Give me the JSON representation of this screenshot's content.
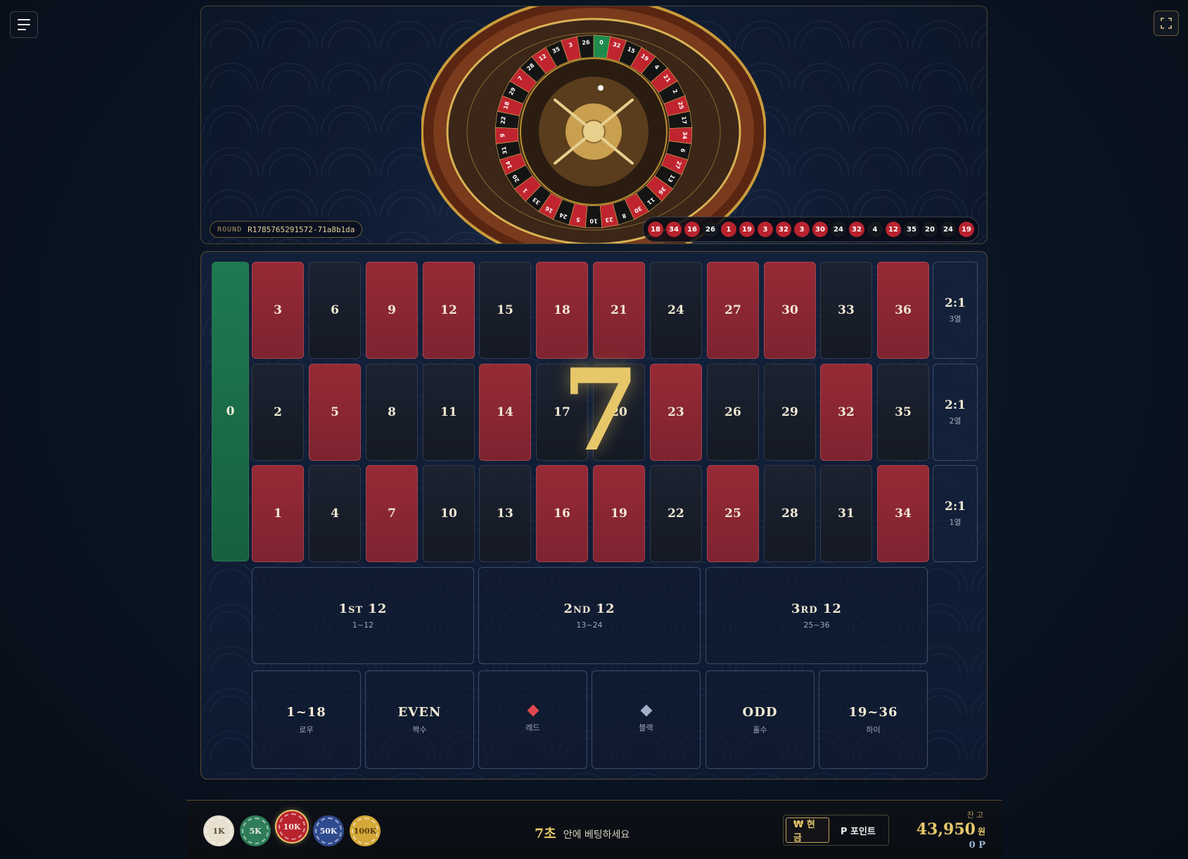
{
  "menu": {
    "icon": "hamburger-icon"
  },
  "fullscreen": {
    "icon": "fullscreen-icon"
  },
  "wheel": {
    "round_label": "ROUND",
    "round_id": "R1785765291572-71a8b1da",
    "pocket_numbers": [
      "0",
      "32",
      "15",
      "19",
      "4",
      "21",
      "2",
      "25",
      "17",
      "34",
      "6",
      "27",
      "13",
      "36",
      "11",
      "30",
      "8",
      "23",
      "10",
      "5",
      "24",
      "16",
      "33",
      "1",
      "20",
      "14",
      "31",
      "9",
      "22",
      "18",
      "29",
      "7",
      "28",
      "12",
      "35",
      "3",
      "26"
    ],
    "history": [
      {
        "n": "18",
        "c": "red"
      },
      {
        "n": "34",
        "c": "red"
      },
      {
        "n": "16",
        "c": "red"
      },
      {
        "n": "26",
        "c": "black"
      },
      {
        "n": "1",
        "c": "red"
      },
      {
        "n": "19",
        "c": "red"
      },
      {
        "n": "3",
        "c": "red"
      },
      {
        "n": "32",
        "c": "red"
      },
      {
        "n": "3",
        "c": "red"
      },
      {
        "n": "30",
        "c": "red"
      },
      {
        "n": "24",
        "c": "black"
      },
      {
        "n": "32",
        "c": "red"
      },
      {
        "n": "4",
        "c": "black"
      },
      {
        "n": "12",
        "c": "red"
      },
      {
        "n": "35",
        "c": "black"
      },
      {
        "n": "20",
        "c": "black"
      },
      {
        "n": "24",
        "c": "black"
      },
      {
        "n": "19",
        "c": "red"
      }
    ]
  },
  "board": {
    "zero": "0",
    "rows": [
      [
        {
          "n": "3",
          "c": "red"
        },
        {
          "n": "6",
          "c": "black"
        },
        {
          "n": "9",
          "c": "red"
        },
        {
          "n": "12",
          "c": "red"
        },
        {
          "n": "15",
          "c": "black"
        },
        {
          "n": "18",
          "c": "red"
        },
        {
          "n": "21",
          "c": "red"
        },
        {
          "n": "24",
          "c": "black"
        },
        {
          "n": "27",
          "c": "red"
        },
        {
          "n": "30",
          "c": "red"
        },
        {
          "n": "33",
          "c": "black"
        },
        {
          "n": "36",
          "c": "red"
        }
      ],
      [
        {
          "n": "2",
          "c": "black"
        },
        {
          "n": "5",
          "c": "red"
        },
        {
          "n": "8",
          "c": "black"
        },
        {
          "n": "11",
          "c": "black"
        },
        {
          "n": "14",
          "c": "red"
        },
        {
          "n": "17",
          "c": "black"
        },
        {
          "n": "20",
          "c": "black"
        },
        {
          "n": "23",
          "c": "red"
        },
        {
          "n": "26",
          "c": "black"
        },
        {
          "n": "29",
          "c": "black"
        },
        {
          "n": "32",
          "c": "red"
        },
        {
          "n": "35",
          "c": "black"
        }
      ],
      [
        {
          "n": "1",
          "c": "red"
        },
        {
          "n": "4",
          "c": "black"
        },
        {
          "n": "7",
          "c": "red"
        },
        {
          "n": "10",
          "c": "black"
        },
        {
          "n": "13",
          "c": "black"
        },
        {
          "n": "16",
          "c": "red"
        },
        {
          "n": "19",
          "c": "red"
        },
        {
          "n": "22",
          "c": "black"
        },
        {
          "n": "25",
          "c": "red"
        },
        {
          "n": "28",
          "c": "black"
        },
        {
          "n": "31",
          "c": "black"
        },
        {
          "n": "34",
          "c": "red"
        }
      ]
    ],
    "columns": [
      {
        "ratio": "2:1",
        "label": "3열"
      },
      {
        "ratio": "2:1",
        "label": "2열"
      },
      {
        "ratio": "2:1",
        "label": "1열"
      }
    ],
    "dozens": [
      {
        "label": "1st 12",
        "range": "1~12"
      },
      {
        "label": "2nd 12",
        "range": "13~24"
      },
      {
        "label": "3rd 12",
        "range": "25~36"
      }
    ],
    "outside": [
      {
        "label": "1~18",
        "sub": "로우",
        "type": "text"
      },
      {
        "label": "EVEN",
        "sub": "짝수",
        "type": "text"
      },
      {
        "label": "",
        "sub": "레드",
        "type": "diamond",
        "color": "#e0474f"
      },
      {
        "label": "",
        "sub": "블랙",
        "type": "diamond",
        "color": "#9fb0c8"
      },
      {
        "label": "ODD",
        "sub": "홀수",
        "type": "text"
      },
      {
        "label": "19~36",
        "sub": "하이",
        "type": "text"
      }
    ],
    "result": "7"
  },
  "chips": [
    {
      "label": "1K",
      "bg": "#e8e0cf",
      "fg": "#5a4a30",
      "selected": false
    },
    {
      "label": "5K",
      "bg": "#2e7d58",
      "fg": "#f0efe6",
      "selected": false
    },
    {
      "label": "10K",
      "bg": "#b8232e",
      "fg": "#f7e9e0",
      "selected": true
    },
    {
      "label": "50K",
      "bg": "#2f4b8f",
      "fg": "#eef0f7",
      "selected": false
    },
    {
      "label": "100K",
      "bg": "#d4a838",
      "fg": "#5a3f10",
      "selected": false
    }
  ],
  "timer": {
    "seconds": "7초",
    "message": "안에 베팅하세요"
  },
  "currency_toggle": {
    "cash": "₩ 현금",
    "points": "P 포인트"
  },
  "balance": {
    "label": "잔고",
    "amount": "43,950",
    "unit": "원",
    "points": "0",
    "points_unit": "P"
  },
  "colors": {
    "red": "#962a35",
    "black": "#1c2230",
    "green": "#1d7a51",
    "gold": "#e6c86a"
  }
}
